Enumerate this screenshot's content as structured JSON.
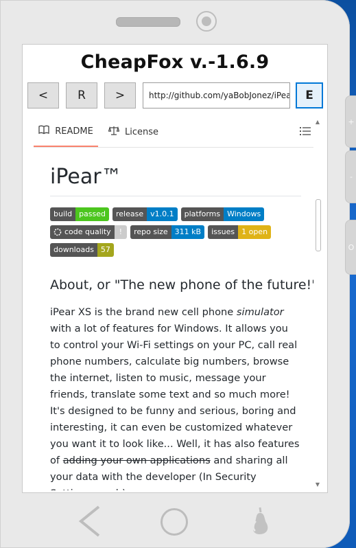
{
  "app": {
    "title": "CheapFox v.-1.6.9"
  },
  "toolbar": {
    "back_label": "<",
    "reload_label": "R",
    "forward_label": ">",
    "url": "http://github.com/yaBobJonez/iPear",
    "go_label": "E"
  },
  "side_buttons": {
    "plus": "+",
    "minus": "-",
    "power": "O"
  },
  "tabs": [
    {
      "label": "README",
      "icon": "book-icon",
      "active": true
    },
    {
      "label": "License",
      "icon": "scale-icon",
      "active": false
    }
  ],
  "readme": {
    "title": "iPear™",
    "badges": [
      {
        "label": "build",
        "value": "passed",
        "color": "#4cc61e"
      },
      {
        "label": "release",
        "value": "v1.0.1",
        "color": "#007ec6"
      },
      {
        "label": "platforms",
        "value": "Windows",
        "color": "#007ec6"
      },
      {
        "label": "code quality",
        "value": "!",
        "color": "#cccccc"
      },
      {
        "label": "repo size",
        "value": "311 kB",
        "color": "#007ec6"
      },
      {
        "label": "issues",
        "value": "1 open",
        "color": "#dfb317"
      },
      {
        "label": "downloads",
        "value": "57",
        "color": "#a4a61d"
      }
    ],
    "heading": "About, or \"The new phone of the future!\"",
    "para_1": "iPear XS is the brand new cell phone ",
    "para_em": "simulator",
    "para_2": " with a lot of features for Windows. It allows you to control your Wi-Fi settings on your PC, call real phone numbers, calculate big numbers, browse the internet, listen to music, message your friends, translate some text and so much more! It's designed to be funny and serious, boring and interesting, it can even be customized whatever you want it to look like... Well, it has also features of ",
    "para_strike": "adding your own applications",
    "para_3": " and sharing all your data with the developer (In Security Settings, yeah)"
  },
  "colors": {
    "accent": "#0078d7",
    "tab_underline": "#f9826c",
    "background": "#1565c0"
  }
}
